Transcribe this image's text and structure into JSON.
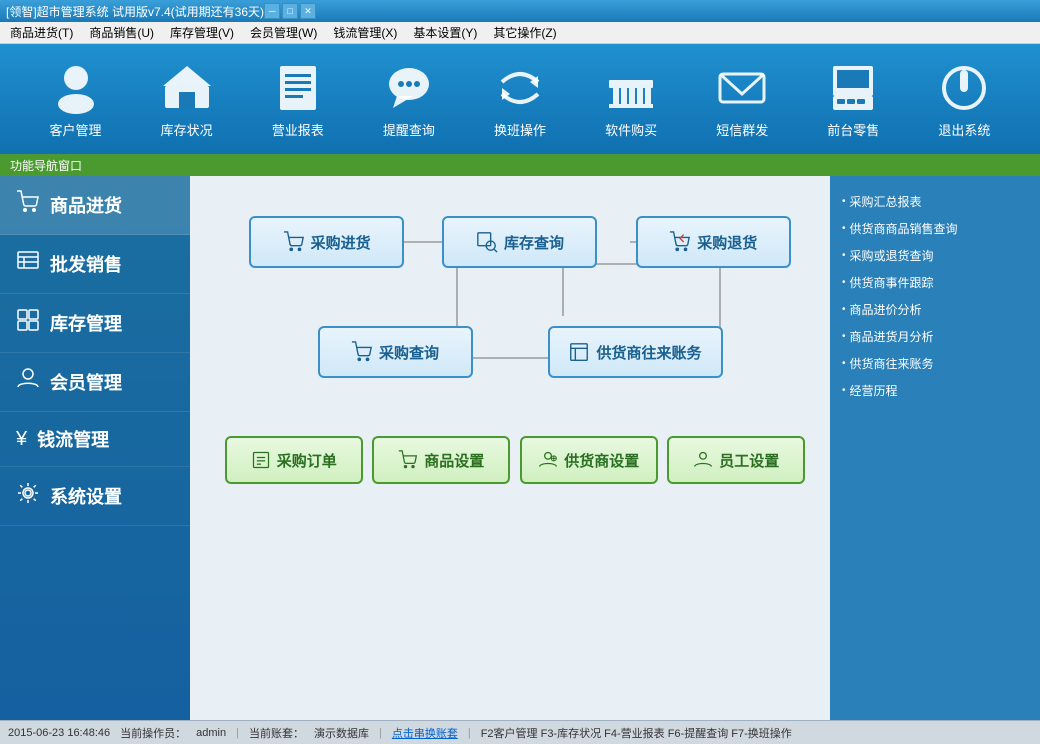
{
  "titlebar": {
    "text": "[领智]超市管理系统 试用版v7.4(试用期还有36天)",
    "min": "─",
    "max": "□",
    "close": "✕"
  },
  "menubar": {
    "items": [
      {
        "label": "商品进货(T)"
      },
      {
        "label": "商品销售(U)"
      },
      {
        "label": "库存管理(V)"
      },
      {
        "label": "会员管理(W)"
      },
      {
        "label": "钱流管理(X)"
      },
      {
        "label": "基本设置(Y)"
      },
      {
        "label": "其它操作(Z)"
      }
    ]
  },
  "toolbar": {
    "items": [
      {
        "id": "customer",
        "label": "客户管理",
        "icon": "👤"
      },
      {
        "id": "inventory",
        "label": "库存状况",
        "icon": "🏠"
      },
      {
        "id": "report",
        "label": "营业报表",
        "icon": "📋"
      },
      {
        "id": "remind",
        "label": "提醒查询",
        "icon": "💬"
      },
      {
        "id": "shift",
        "label": "换班操作",
        "icon": "🔄"
      },
      {
        "id": "buy",
        "label": "软件购买",
        "icon": "🛒"
      },
      {
        "id": "sms",
        "label": "短信群发",
        "icon": "✉"
      },
      {
        "id": "pos",
        "label": "前台零售",
        "icon": "💰"
      },
      {
        "id": "exit",
        "label": "退出系统",
        "icon": "⏻"
      }
    ]
  },
  "funcnav": {
    "label": "功能导航窗口"
  },
  "sidebar": {
    "items": [
      {
        "id": "purchase",
        "label": "商品进货",
        "icon": "🛒",
        "active": true
      },
      {
        "id": "wholesale",
        "label": "批发销售",
        "icon": "📋"
      },
      {
        "id": "inventory",
        "label": "库存管理",
        "icon": "⊞"
      },
      {
        "id": "member",
        "label": "会员管理",
        "icon": "👤"
      },
      {
        "id": "cashflow",
        "label": "钱流管理",
        "icon": "¥"
      },
      {
        "id": "settings",
        "label": "系统设置",
        "icon": "⚙"
      }
    ]
  },
  "flowchart": {
    "btn_purchase": "采购进货",
    "btn_inventory": "库存查询",
    "btn_return": "采购退货",
    "btn_query": "采购查询",
    "btn_supplier": "供货商往来账务",
    "btn_order": "采购订单",
    "btn_goods_setup": "商品设置",
    "btn_supplier_setup": "供货商设置",
    "btn_staff_setup": "员工设置"
  },
  "rightpanel": {
    "links": [
      "采购汇总报表",
      "供货商商品销售查询",
      "采购或退货查询",
      "供货商事件跟踪",
      "商品进价分析",
      "商品进货月分析",
      "供货商往来账务",
      "经营历程"
    ]
  },
  "statusbar": {
    "datetime": "2015-06-23 16:48:46",
    "operator_label": "当前操作员：",
    "operator": "admin",
    "account_label": "当前账套：",
    "account": "演示数据库",
    "switch_link": "点击串换账套",
    "shortcuts": "F2客户管理 F3-库存状况 F4-营业报表 F6-提醒查询 F7-换班操作"
  }
}
